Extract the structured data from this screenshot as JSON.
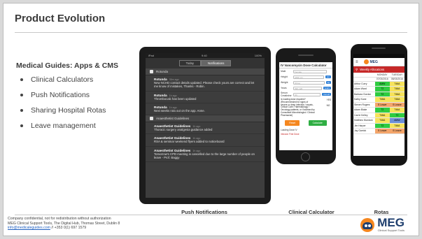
{
  "slide": {
    "title": "Product Evolution",
    "subtitle": "Medical Guides: Apps & CMS",
    "bullets": [
      "Clinical Calculators",
      "Push Notifications",
      "Sharing Hospital Rotas",
      "Leave management"
    ]
  },
  "captions": {
    "tablet": "Push Notifications",
    "calculator": "Clinical Calculator",
    "rotas": "Rotas"
  },
  "tablet": {
    "status_left": "iPad",
    "status_center": "9:40",
    "status_right": "100%",
    "tabs": [
      "Today",
      "Notifications"
    ],
    "groups": [
      {
        "app": "Rotunda",
        "notes": [
          {
            "title": "Rotunda",
            "ago": "35m ago",
            "body": "New NCHD contact details updated. Please check yours are correct and let me know of mistakes, Thanks - Robin."
          },
          {
            "title": "Rotunda",
            "ago": "1h ago",
            "body": "Thrombocalc has been updated"
          },
          {
            "title": "Rotunda",
            "ago": "1h ago",
            "body": "Next weeks rota out on the app. Anne."
          }
        ]
      },
      {
        "app": "Anaesthetist Guidelines",
        "notes": [
          {
            "title": "Anaesthetist Guidelines",
            "ago": "1h ago",
            "body": "Thoracic surgery analgesia guidance added"
          },
          {
            "title": "Anaesthetist Guidelines",
            "ago": "1h ago",
            "body": "RSA & seminar weekend flyers added to noticeboard"
          },
          {
            "title": "Anaesthetist Guidelines",
            "ago": "1h ago",
            "body": "Tomorrow's CPD meeting is cancelled due to the large number of people on leave - Prof. Baggy"
          }
        ]
      }
    ]
  },
  "calculator": {
    "title": "IV Vancomycin Dose Calculator",
    "fields": [
      {
        "label": "Male",
        "value": "Female",
        "unit": ""
      },
      {
        "label": "Height",
        "value": "(200) cm",
        "unit": "cm"
      },
      {
        "label": "Weight",
        "value": "(0) kg",
        "unit": "kg"
      },
      {
        "label": "Years",
        "value": "(50) 120",
        "unit": "years"
      },
      {
        "label": "Serum Creatinine",
        "value": "(0)",
        "unit": "mmol/l"
      }
    ],
    "question": "Is loading dose required? (Recommended for signs of severe or deep infection / sepsis, Critical Care / Haematology / Oncology patients, or if advised by Consultant Microbiologist / Clinical Pharmacist)",
    "yes": "YES",
    "no": "NO",
    "reset": "Reset",
    "calculate": "Calculate",
    "foot1": "Loading Dose IV",
    "foot2": "Infusion First Dose"
  },
  "rota": {
    "app_name": "MEG",
    "header": "Weekly Allocations",
    "days": [
      "MONDAY",
      "TUESDAY"
    ],
    "dates": [
      "07/03/2016",
      "08/03/2016"
    ],
    "rows": [
      {
        "name": "Arthur Curry",
        "d1": "AMW",
        "c1": "#2ecc40",
        "d2": "T46A",
        "c2": "#f7e35a"
      },
      {
        "name": "Adam Ward",
        "d1": "T2",
        "c1": "#2ecc40",
        "d2": "T46A",
        "c2": "#f7e35a"
      },
      {
        "name": "Barbara Gordon",
        "d1": "T2",
        "c1": "#2ecc40",
        "d2": "T46A",
        "c2": "#f7e35a"
      },
      {
        "name": "Kathy Kane",
        "d1": "T46A",
        "c1": "#f7e35a",
        "d2": "T46A",
        "c2": "#f7e35a"
      },
      {
        "name": "Steven Rogers",
        "d1": "S Leave",
        "c1": "#f4a56a",
        "d2": "S Leave",
        "c2": "#f4a56a"
      },
      {
        "name": "Adam Blake",
        "d1": "T2",
        "c1": "#2ecc40",
        "d2": "T46A",
        "c2": "#f7e35a"
      },
      {
        "name": "Carrie Kelley",
        "d1": "T46A",
        "c1": "#f7e35a",
        "d2": "T2",
        "c2": "#2ecc40"
      },
      {
        "name": "Matthew Murdock",
        "d1": "T46A",
        "c1": "#f7e35a",
        "d2": "AMW",
        "c2": "#6d8fd8"
      },
      {
        "name": "Jim Harper",
        "d1": "T2",
        "c1": "#2ecc40",
        "d2": "T46A",
        "c2": "#f7e35a"
      },
      {
        "name": "Jay Garrick",
        "d1": "S Leave",
        "c1": "#f4a56a",
        "d2": "S Leave",
        "c2": "#f4a56a"
      }
    ]
  },
  "footer": {
    "line1": "Company confidential, not for redistribution without authorization",
    "line2": "MEG Clinical Support Tools, The Digital Hub, Thomas Street, Dublin 8",
    "email": "info@medicaleguides.com",
    "phone": " //  +353 0(1) 697 1579"
  },
  "logo": {
    "word": "MEG",
    "tagline": "Clinical Support Tools",
    "orange": "#f5871f",
    "navy": "#1f3f6e"
  }
}
